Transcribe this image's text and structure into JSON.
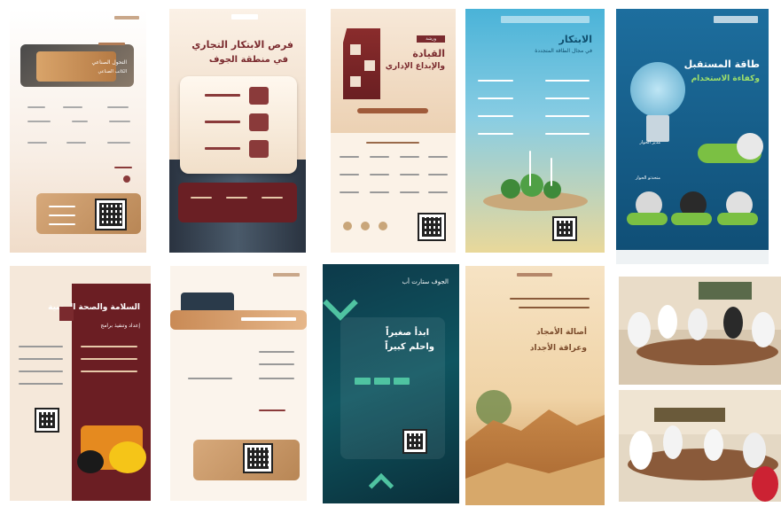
{
  "posters": {
    "p1": {
      "subtitle": "الكاتب الصناعي",
      "title": "التحول الصناعي"
    },
    "p2": {
      "title": "فرص الابتكار التجاري",
      "subtitle": "في منطقة الجوف"
    },
    "p3": {
      "badge": "ورشة",
      "title": "القيادة",
      "subtitle": "والإبداع الإداري"
    },
    "p4": {
      "title": "الابتكار",
      "subtitle": "في مجال الطاقة المتجددة"
    },
    "p5": {
      "title": "طاقة المستقبل",
      "subtitle": "وكفاءة الاستخدام",
      "heading1": "مدير الحوار",
      "heading2": "متحدثو الحوار"
    },
    "p6": {
      "title": "السلامة والصحة المهنية",
      "subtitle": "إعداد وتنفيذ برامج"
    },
    "p8": {
      "line1": "ابدأ صغيراً",
      "line2": "واحلم كبيراً",
      "side": "الجوف ستارت أب"
    },
    "p9": {
      "line1": "أصالة الأمجاد",
      "line2": "وعراقة الأجداد"
    }
  },
  "colors": {
    "maroon": "#7a2a2e",
    "teal": "#1f6fa0",
    "navy": "#163b52",
    "sand": "#e6c79c",
    "cream": "#fbeee0"
  }
}
